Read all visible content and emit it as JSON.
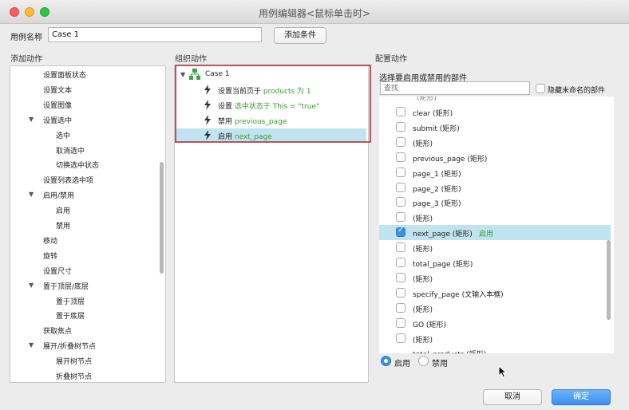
{
  "window": {
    "title": "用例编辑器<鼠标单击时>"
  },
  "case_name": {
    "label": "用例名称",
    "value": "Case 1",
    "add_condition_label": "添加条件"
  },
  "add_actions": {
    "title": "添加动作",
    "items": [
      {
        "label": "设置面板状态",
        "level": 1,
        "toggle": ""
      },
      {
        "label": "设置文本",
        "level": 1,
        "toggle": ""
      },
      {
        "label": "设置图像",
        "level": 1,
        "toggle": ""
      },
      {
        "label": "设置选中",
        "level": 1,
        "toggle": "▼"
      },
      {
        "label": "选中",
        "level": 2,
        "toggle": ""
      },
      {
        "label": "取消选中",
        "level": 2,
        "toggle": ""
      },
      {
        "label": "切换选中状态",
        "level": 2,
        "toggle": ""
      },
      {
        "label": "设置列表选中项",
        "level": 1,
        "toggle": ""
      },
      {
        "label": "启用/禁用",
        "level": 1,
        "toggle": "▼"
      },
      {
        "label": "启用",
        "level": 2,
        "toggle": ""
      },
      {
        "label": "禁用",
        "level": 2,
        "toggle": ""
      },
      {
        "label": "移动",
        "level": 1,
        "toggle": ""
      },
      {
        "label": "旋转",
        "level": 1,
        "toggle": ""
      },
      {
        "label": "设置尺寸",
        "level": 1,
        "toggle": ""
      },
      {
        "label": "置于顶层/底层",
        "level": 1,
        "toggle": "▼"
      },
      {
        "label": "置于顶层",
        "level": 2,
        "toggle": ""
      },
      {
        "label": "置于底层",
        "level": 2,
        "toggle": ""
      },
      {
        "label": "获取焦点",
        "level": 1,
        "toggle": ""
      },
      {
        "label": "展开/折叠树节点",
        "level": 1,
        "toggle": "▼"
      },
      {
        "label": "展开树节点",
        "level": 2,
        "toggle": ""
      },
      {
        "label": "折叠树节点",
        "level": 2,
        "toggle": ""
      }
    ]
  },
  "organize": {
    "title": "组织动作",
    "case_label": "Case 1",
    "actions": [
      {
        "prefix": "设置当前页于 ",
        "highlight": "products 为 1",
        "selected": false
      },
      {
        "prefix": "设置 ",
        "highlight": "选中状态于 This = \"true\"",
        "selected": false
      },
      {
        "prefix": "禁用 ",
        "highlight": "previous_page",
        "selected": false
      },
      {
        "prefix": "启用 ",
        "highlight": "next_page",
        "selected": true
      }
    ]
  },
  "configure": {
    "title": "配置动作",
    "prompt": "选择要启用或禁用的部件",
    "search_placeholder": "查找",
    "hide_unnamed_label": "隐藏未命名的部件",
    "partial_top": "(矩形)",
    "partial_bottom": "total_products (矩形)",
    "widgets": [
      {
        "label": "clear (矩形)",
        "checked": false,
        "status": ""
      },
      {
        "label": "submit (矩形)",
        "checked": false,
        "status": ""
      },
      {
        "label": "(矩形)",
        "checked": false,
        "status": ""
      },
      {
        "label": "previous_page (矩形)",
        "checked": false,
        "status": ""
      },
      {
        "label": "page_1 (矩形)",
        "checked": false,
        "status": ""
      },
      {
        "label": "page_2 (矩形)",
        "checked": false,
        "status": ""
      },
      {
        "label": "page_3 (矩形)",
        "checked": false,
        "status": ""
      },
      {
        "label": "(矩形)",
        "checked": false,
        "status": ""
      },
      {
        "label": "next_page (矩形)",
        "checked": true,
        "status": "启用"
      },
      {
        "label": "(矩形)",
        "checked": false,
        "status": ""
      },
      {
        "label": "total_page (矩形)",
        "checked": false,
        "status": ""
      },
      {
        "label": "(矩形)",
        "checked": false,
        "status": ""
      },
      {
        "label": "specify_page (文输入本框)",
        "checked": false,
        "status": ""
      },
      {
        "label": "(矩形)",
        "checked": false,
        "status": ""
      },
      {
        "label": "GO (矩形)",
        "checked": false,
        "status": ""
      },
      {
        "label": "(矩形)",
        "checked": false,
        "status": ""
      }
    ],
    "enable_label": "启用",
    "disable_label": "禁用",
    "selected_mode": "enable"
  },
  "footer": {
    "cancel_label": "取消",
    "ok_label": "确定"
  },
  "colors": {
    "accent": "#3d8fe0",
    "selection": "#bfe4ef",
    "highlight_text": "#3a9c2c",
    "case_border": "#b85460"
  }
}
